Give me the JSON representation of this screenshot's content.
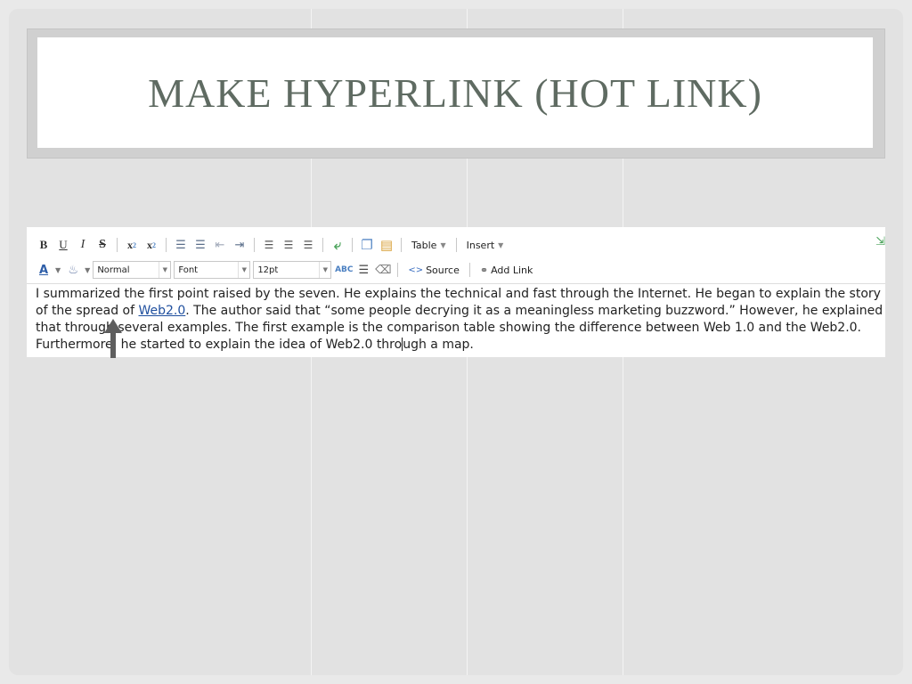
{
  "slide": {
    "title": "MAKE HYPERLINK (HOT LINK)"
  },
  "toolbar": {
    "bold": "B",
    "underline": "U",
    "italic": "I",
    "strike": "S",
    "subscript": "x",
    "superscript": "x",
    "subscript_mark": "2",
    "superscript_mark": "2",
    "table_label": "Table",
    "insert_label": "Insert",
    "color_label": "A",
    "style_select": "Normal",
    "font_select": "Font",
    "size_select": "12pt",
    "spell_label": "ABC",
    "source_label": "Source",
    "add_link_label": "Add Link"
  },
  "content": {
    "before_link": "I summarized the first point raised by the seven. He explains the technical and fast through the Internet. He began to explain the story of the spread of ",
    "link_text": "Web2.0",
    "after_link": ". The author said that “some people decrying it as a meaningless marketing buzzword.” However, he explained that through several examples. The first example is the comparison table showing the difference between Web 1.0 and the Web2.0. Furthermore, he started to explain the idea of Web2.0 thro",
    "after_caret": "ugh a map."
  },
  "colors": {
    "title": "#5f6b62",
    "link": "#1f4f9e",
    "background": "#e2e2e2",
    "arrow": "#5e5e5e"
  }
}
